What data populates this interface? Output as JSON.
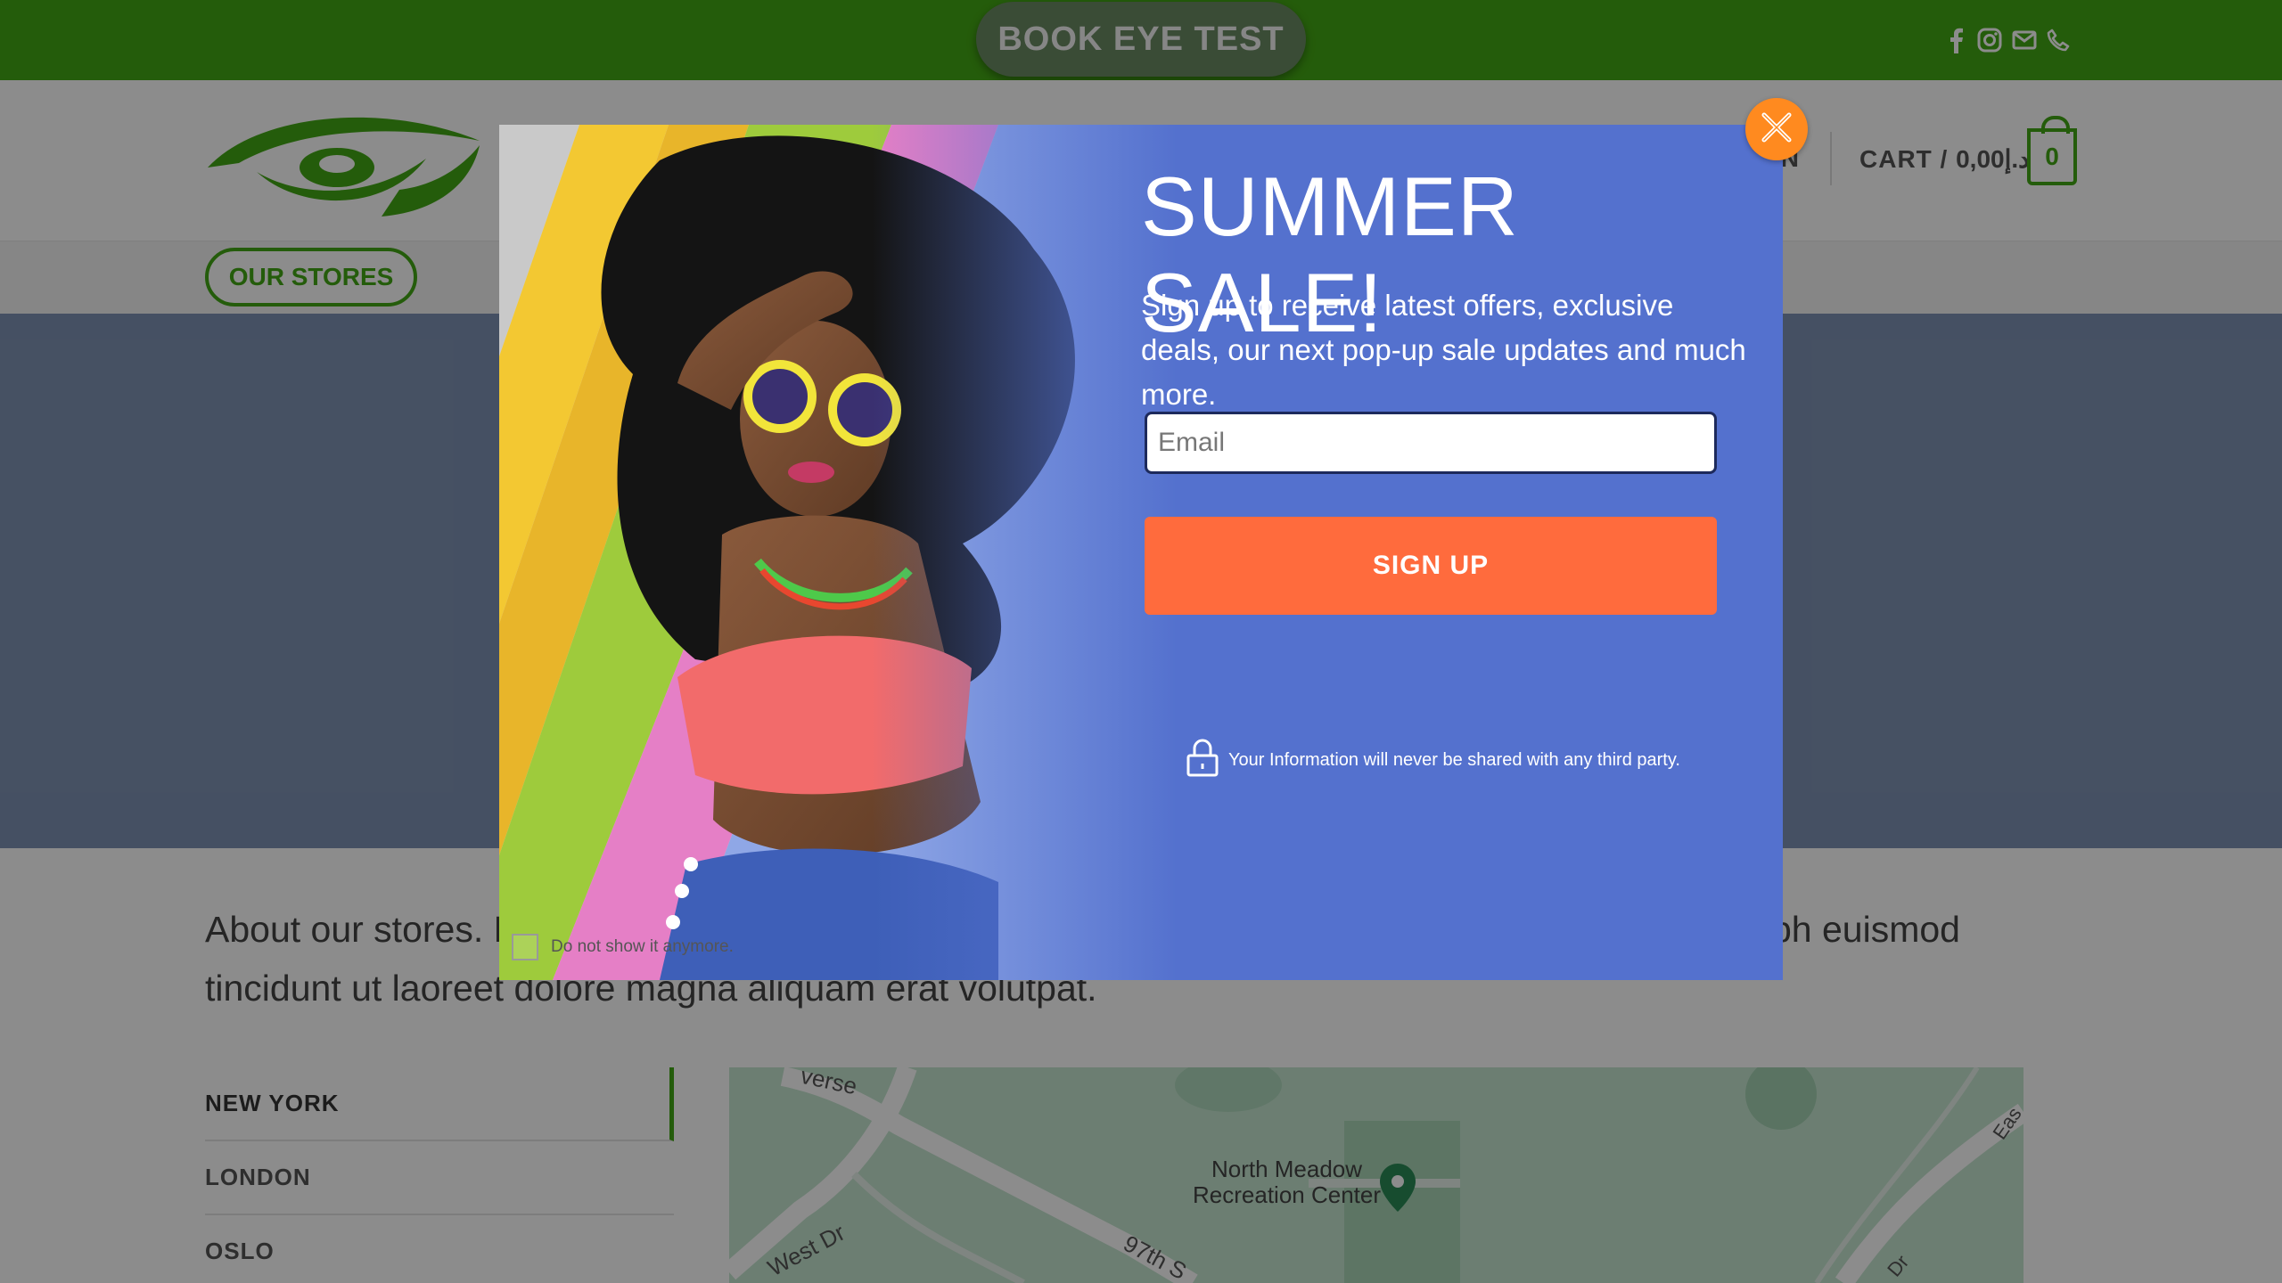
{
  "topbar": {
    "book_button": "BOOK EYE TEST",
    "social_icons": [
      "facebook-icon",
      "instagram-icon",
      "email-icon",
      "phone-icon"
    ]
  },
  "header": {
    "nav_partial": "IN",
    "cart_label": "CART / ",
    "cart_currency_symbol": "د.إ",
    "cart_amount": "0,00",
    "cart_count": "0",
    "stores_button": "OUR STORES"
  },
  "content": {
    "about_text": "About our stores. Lorem ipsum dolor sit amet, consectetuer adipiscing elit, sed diam nonummy nibh euismod tincidunt ut laoreet dolore magna aliquam erat volutpat.",
    "stores": [
      "NEW YORK",
      "LONDON",
      "OSLO"
    ],
    "map_labels": {
      "poi_line1": "North Meadow",
      "poi_line2": "Recreation Center",
      "road_west": "West Dr",
      "road_97": "97th S",
      "road_top": "verse",
      "road_east": "Eas",
      "road_dr": "Dr"
    }
  },
  "popup": {
    "title": "SUMMER SALE!",
    "description": "Sign up to receive latest offers, exclusive deals, our next pop-up sale updates and much more.",
    "email_placeholder": "Email",
    "signup_button": "SIGN UP",
    "privacy_text": "Your Information will never be shared with any third party.",
    "dont_show_label": "Do not show it anymore."
  },
  "colors": {
    "brand_green": "#43a814",
    "popup_blue": "#5471ce",
    "signup_orange": "#ff6b3d",
    "close_orange": "#ff8a1f"
  }
}
